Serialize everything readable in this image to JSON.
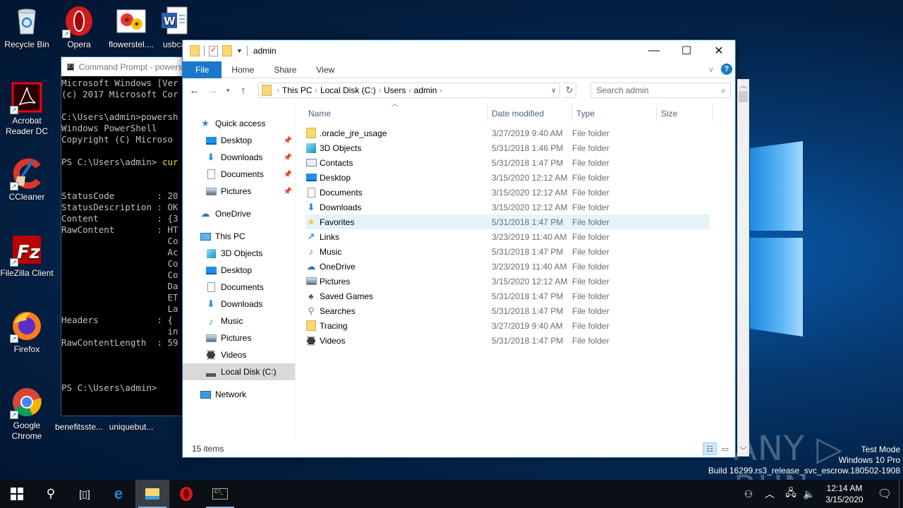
{
  "desktop": {
    "icons": [
      {
        "label": "Recycle Bin",
        "icon": "recycle-bin-icon"
      },
      {
        "label": "Opera",
        "icon": "opera-icon"
      },
      {
        "label": "flowerstel....",
        "icon": "image-file-icon"
      },
      {
        "label": "usbca",
        "icon": "word-document-icon"
      },
      {
        "label": "Acrobat Reader DC",
        "icon": "acrobat-icon"
      },
      {
        "label": "CCleaner",
        "icon": "ccleaner-icon"
      },
      {
        "label": "FileZilla Client",
        "icon": "filezilla-icon"
      },
      {
        "label": "Firefox",
        "icon": "firefox-icon"
      },
      {
        "label": "Google Chrome",
        "icon": "chrome-icon"
      },
      {
        "label": "benefitsste...",
        "icon": "file-icon"
      },
      {
        "label": "uniquebut...",
        "icon": "file-icon"
      }
    ],
    "watermark": "ANY ▷ RUN",
    "os_info": [
      "Test Mode",
      "Windows 10 Pro",
      "Build 16299.rs3_release_svc_escrow.180502-1908"
    ]
  },
  "cmd": {
    "title": "Command Prompt - powershell",
    "lines": [
      "Microsoft Windows [Ver",
      "(c) 2017 Microsoft Cor",
      "",
      "C:\\Users\\admin>powersh",
      "Windows PowerShell",
      "Copyright (C) Microso",
      "",
      "PS C:\\Users\\admin> cur",
      "",
      "",
      "StatusCode        : 20",
      "StatusDescription : OK",
      "Content           : {3",
      "RawContent        : HT",
      "                    Co",
      "                    Ac",
      "                    Co",
      "                    Co",
      "                    Da",
      "                    ET",
      "                    La",
      "Headers           : {",
      "                    in",
      "RawContentLength  : 59",
      "",
      "",
      "",
      "PS C:\\Users\\admin>"
    ]
  },
  "explorer": {
    "title": "admin",
    "ribbon_tabs": [
      "File",
      "Home",
      "Share",
      "View"
    ],
    "breadcrumb": [
      "This PC",
      "Local Disk (C:)",
      "Users",
      "admin"
    ],
    "search_placeholder": "Search admin",
    "nav": {
      "quick_access": "Quick access",
      "quick_items": [
        "Desktop",
        "Downloads",
        "Documents",
        "Pictures"
      ],
      "onedrive": "OneDrive",
      "this_pc": "This PC",
      "pc_items": [
        "3D Objects",
        "Desktop",
        "Documents",
        "Downloads",
        "Music",
        "Pictures",
        "Videos",
        "Local Disk (C:)"
      ],
      "network": "Network"
    },
    "columns": [
      "Name",
      "Date modified",
      "Type",
      "Size"
    ],
    "files": [
      {
        "name": ".oracle_jre_usage",
        "date": "3/27/2019 9:40 AM",
        "type": "File folder",
        "icon": "folder-icon"
      },
      {
        "name": "3D Objects",
        "date": "5/31/2018 1:46 PM",
        "type": "File folder",
        "icon": "3d-objects-icon"
      },
      {
        "name": "Contacts",
        "date": "5/31/2018 1:47 PM",
        "type": "File folder",
        "icon": "contacts-icon"
      },
      {
        "name": "Desktop",
        "date": "3/15/2020 12:12 AM",
        "type": "File folder",
        "icon": "desktop-icon"
      },
      {
        "name": "Documents",
        "date": "3/15/2020 12:12 AM",
        "type": "File folder",
        "icon": "documents-icon"
      },
      {
        "name": "Downloads",
        "date": "3/15/2020 12:12 AM",
        "type": "File folder",
        "icon": "downloads-icon"
      },
      {
        "name": "Favorites",
        "date": "5/31/2018 1:47 PM",
        "type": "File folder",
        "icon": "favorites-icon"
      },
      {
        "name": "Links",
        "date": "3/23/2019 11:40 AM",
        "type": "File folder",
        "icon": "links-icon"
      },
      {
        "name": "Music",
        "date": "5/31/2018 1:47 PM",
        "type": "File folder",
        "icon": "music-icon"
      },
      {
        "name": "OneDrive",
        "date": "3/23/2019 11:40 AM",
        "type": "File folder",
        "icon": "onedrive-icon"
      },
      {
        "name": "Pictures",
        "date": "3/15/2020 12:12 AM",
        "type": "File folder",
        "icon": "pictures-icon"
      },
      {
        "name": "Saved Games",
        "date": "5/31/2018 1:47 PM",
        "type": "File folder",
        "icon": "saved-games-icon"
      },
      {
        "name": "Searches",
        "date": "5/31/2018 1:47 PM",
        "type": "File folder",
        "icon": "searches-icon"
      },
      {
        "name": "Tracing",
        "date": "3/27/2019 9:40 AM",
        "type": "File folder",
        "icon": "folder-icon"
      },
      {
        "name": "Videos",
        "date": "5/31/2018 1:47 PM",
        "type": "File folder",
        "icon": "videos-icon"
      }
    ],
    "highlighted_row": "Favorites",
    "status": "15 items"
  },
  "taskbar": {
    "time": "12:14 AM",
    "date": "3/15/2020"
  },
  "colors": {
    "accent": "#1979ca",
    "hover_row": "#e5f3fb",
    "selected_nav": "#d9d9d9"
  }
}
